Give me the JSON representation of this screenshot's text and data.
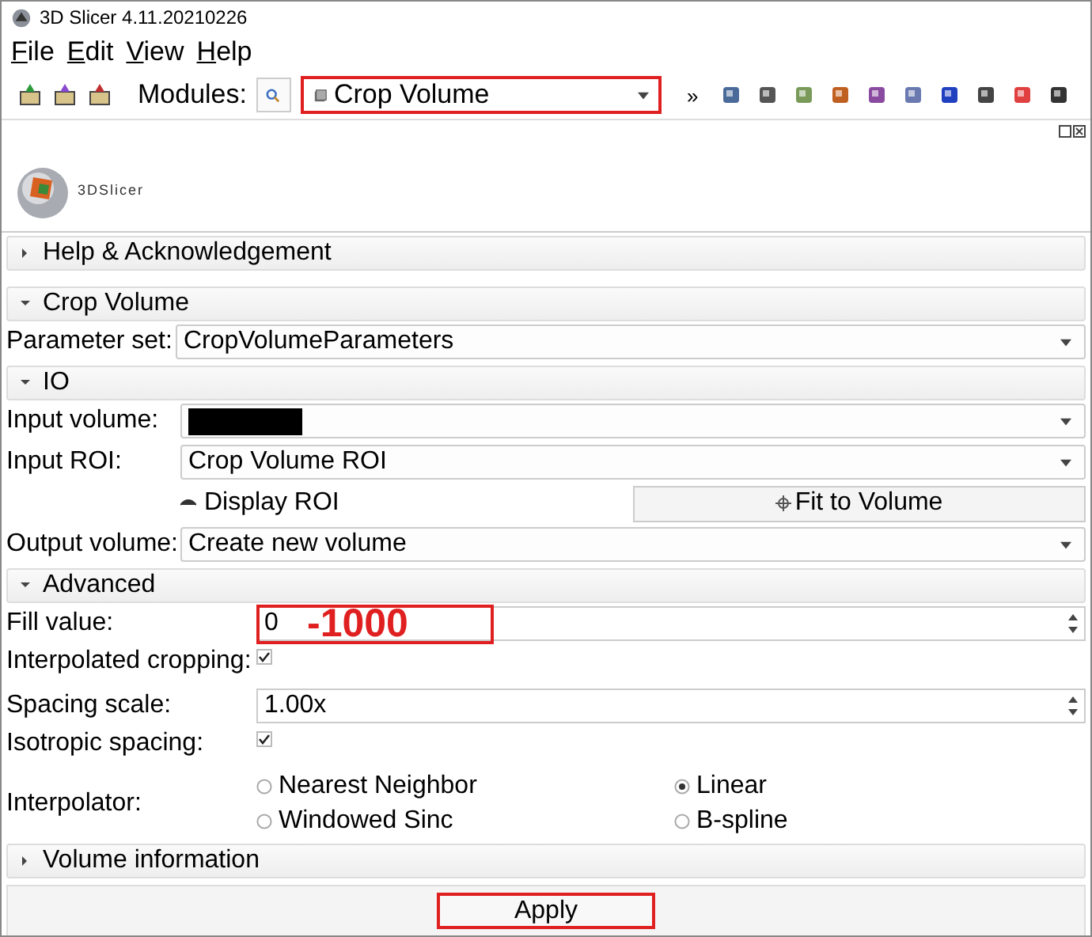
{
  "window": {
    "title": "3D Slicer 4.11.20210226"
  },
  "menu": [
    {
      "label": "File"
    },
    {
      "label": "Edit"
    },
    {
      "label": "View"
    },
    {
      "label": "Help"
    }
  ],
  "toolbar": {
    "modules_label": "Modules:",
    "module": "Crop Volume",
    "module_highlighted": true,
    "more": "»"
  },
  "logo": {
    "text": "3DSlicer"
  },
  "sections": [
    {
      "kind": "collapsible",
      "title": "Help & Acknowledgement",
      "expanded": false
    },
    {
      "kind": "collapsible",
      "title": "Crop Volume",
      "expanded": true
    },
    {
      "kind": "combo",
      "label": "Parameter set:",
      "value": "CropVolumeParameters"
    },
    {
      "kind": "collapsible",
      "title": "IO",
      "expanded": true
    },
    {
      "kind": "combo",
      "label": "Input volume:",
      "redacted": true
    },
    {
      "kind": "combo",
      "label": "Input ROI:",
      "value": "Crop Volume ROI"
    },
    {
      "kind": "roi",
      "toggle": "Display ROI",
      "visible": true,
      "button": "Fit to Volume"
    },
    {
      "kind": "combo",
      "label": "Output volume:",
      "value": "Create new volume"
    },
    {
      "kind": "collapsible",
      "title": "Advanced",
      "expanded": true
    },
    {
      "kind": "spin",
      "label": "Fill value:",
      "value": "0",
      "highlighted": true,
      "annotation": "-1000"
    },
    {
      "kind": "check",
      "label": "Interpolated cropping:",
      "checked": true
    },
    {
      "kind": "spin",
      "label": "Spacing scale:",
      "value": "1.00x"
    },
    {
      "kind": "check",
      "label": "Isotropic spacing:",
      "checked": true
    },
    {
      "kind": "radios",
      "label": "Interpolator:",
      "options": [
        {
          "label": "Nearest Neighbor",
          "selected": false
        },
        {
          "label": "Linear",
          "selected": true
        },
        {
          "label": "Windowed Sinc",
          "selected": false
        },
        {
          "label": "B-spline",
          "selected": false
        }
      ]
    },
    {
      "kind": "collapsible",
      "title": "Volume information",
      "expanded": false
    }
  ],
  "apply": {
    "label": "Apply",
    "highlighted": true
  }
}
